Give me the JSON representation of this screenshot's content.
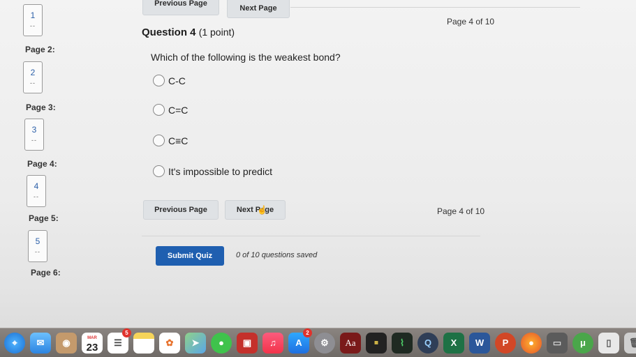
{
  "sidebar": {
    "pages": [
      {
        "num": "1",
        "dash": "--",
        "label": ""
      },
      {
        "num": "2",
        "dash": "--",
        "label": "Page 2:"
      },
      {
        "num": "3",
        "dash": "--",
        "label": "Page 3:"
      },
      {
        "num": "4",
        "dash": "--",
        "label": "Page 4:"
      },
      {
        "num": "5",
        "dash": "--",
        "label": "Page 5:"
      },
      {
        "num": "",
        "dash": "",
        "label": "Page 6:"
      }
    ]
  },
  "nav_top": {
    "prev": "Previous Page",
    "next": "Next Page",
    "page_indicator": "Page 4 of 10"
  },
  "question": {
    "title": "Question 4",
    "points": "(1 point)",
    "text": "Which of the following is the weakest bond?",
    "options": [
      "C-C",
      "C=C",
      "C≡C",
      "It's impossible to predict"
    ]
  },
  "nav_bottom": {
    "prev": "Previous Page",
    "next": "Next Page",
    "page_indicator": "Page 4 of 10"
  },
  "submit": {
    "label": "Submit Quiz",
    "status": "0 of 10 questions saved"
  },
  "dock": {
    "calendar_month": "MAR",
    "calendar_day": "23",
    "reminders_badge": "5",
    "appstore_badge": "2",
    "dictionary_glyph": "Aa",
    "icons": [
      "safari-icon",
      "mail-icon",
      "contacts-icon",
      "calendar-icon",
      "reminders-icon",
      "notes-icon",
      "photos-icon",
      "maps-icon",
      "messages-icon",
      "photo-booth-icon",
      "music-icon",
      "app-store-icon",
      "system-preferences-icon",
      "dictionary-icon",
      "console-icon",
      "activity-monitor-icon",
      "quicktime-icon",
      "excel-icon",
      "word-icon",
      "powerpoint-icon",
      "firefox-icon",
      "disk-utility-icon",
      "utorrent-icon",
      "file-icon",
      "trash-icon"
    ]
  }
}
